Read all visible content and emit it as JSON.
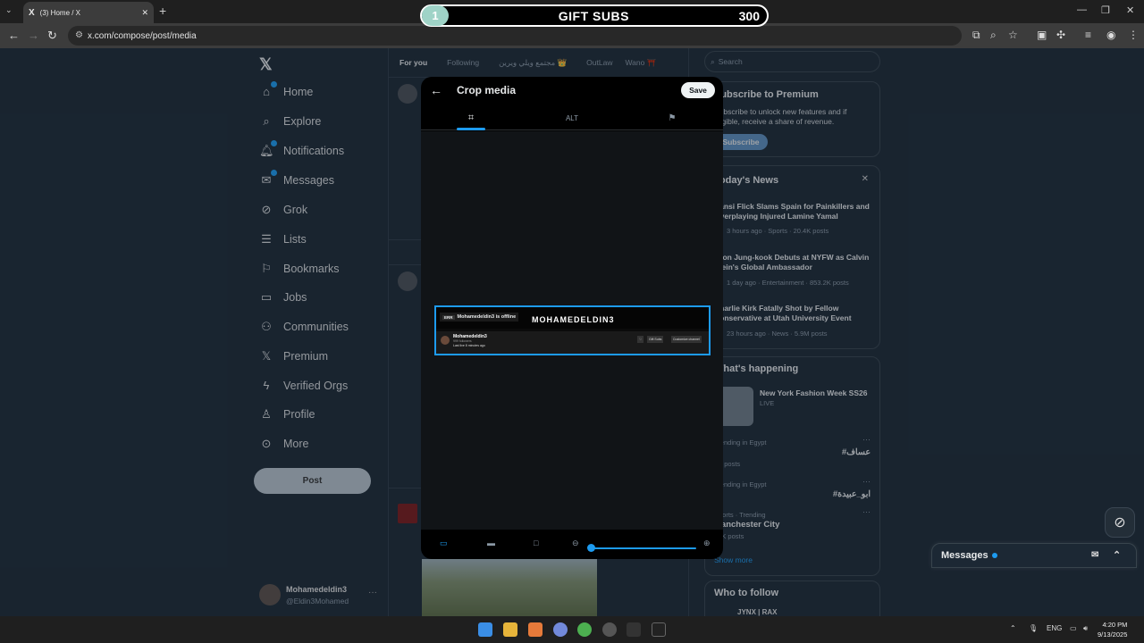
{
  "browser": {
    "tab_title": "(3) Home / X",
    "tab_logo": "X",
    "url": "x.com/compose/post/media"
  },
  "overlay": {
    "gift_number": "1",
    "gift_label": "GIFT SUBS",
    "gift_count": "300"
  },
  "sidebar": {
    "items": [
      {
        "label": "Home",
        "icon": "home-icon"
      },
      {
        "label": "Explore",
        "icon": "search-icon"
      },
      {
        "label": "Notifications",
        "icon": "bell-icon"
      },
      {
        "label": "Messages",
        "icon": "mail-icon"
      },
      {
        "label": "Grok",
        "icon": "grok-icon"
      },
      {
        "label": "Lists",
        "icon": "list-icon"
      },
      {
        "label": "Bookmarks",
        "icon": "bookmark-icon"
      },
      {
        "label": "Jobs",
        "icon": "briefcase-icon"
      },
      {
        "label": "Communities",
        "icon": "people-icon"
      },
      {
        "label": "Premium",
        "icon": "x-icon"
      },
      {
        "label": "Verified Orgs",
        "icon": "lightning-icon"
      },
      {
        "label": "Profile",
        "icon": "person-icon"
      },
      {
        "label": "More",
        "icon": "more-icon"
      }
    ],
    "post_label": "Post",
    "account_name": "Mohamedeldin3",
    "account_handle": "@Eldin3Mohamed"
  },
  "feed": {
    "tabs": [
      "For you",
      "Following",
      "مجتمع ويلي ويرين 👑",
      "OutLaw",
      "Wano ⛩️"
    ]
  },
  "modal": {
    "title": "Crop media",
    "save_label": "Save",
    "alt_label": "ALT",
    "preview": {
      "offline_tag": "ERR",
      "offline_text": "Mohamedeldin3 is offline",
      "brand": "MOHAMEDELDIN3",
      "channel_name": "Mohamedeldin3",
      "channel_sub": "999 followers",
      "channel_live": "Last live 8 minutes ago",
      "gift_btn": "Gift Subs",
      "customize_btn": "Customize channel"
    },
    "zoom_level": 0
  },
  "right": {
    "search_placeholder": "Search",
    "premium_title": "Subscribe to Premium",
    "premium_text": "Subscribe to unlock new features and if eligible, receive a share of revenue.",
    "subscribe_label": "Subscribe",
    "news_title": "Today's News",
    "news": [
      {
        "title": "Hansi Flick Slams Spain for Painkillers and Overplaying Injured Lamine Yamal",
        "meta": "3 hours ago · Sports · 20.4K posts"
      },
      {
        "title": "Jeon Jung-kook Debuts at NYFW as Calvin Klein's Global Ambassador",
        "meta": "1 day ago · Entertainment · 853.2K posts"
      },
      {
        "title": "Charlie Kirk Fatally Shot by Fellow Conservative at Utah University Event",
        "meta": "23 hours ago · News · 5.9M posts"
      }
    ],
    "happening_title": "What's happening",
    "event_title": "New York Fashion Week SS26",
    "event_status": "LIVE",
    "trends": [
      {
        "context": "Trending in Egypt",
        "name": "#عساف",
        "posts": "4K posts"
      },
      {
        "context": "Trending in Egypt",
        "name": "#ابو_عبيدة",
        "posts": ""
      },
      {
        "context": "Sports · Trending",
        "name": "Manchester City",
        "posts": "17K posts"
      }
    ],
    "show_more": "Show more",
    "who_to_follow": "Who to follow",
    "follow_name": "JYNX | RAX",
    "messages_label": "Messages"
  },
  "taskbar": {
    "lang": "ENG",
    "time": "4:20 PM",
    "date": "9/13/2025"
  }
}
